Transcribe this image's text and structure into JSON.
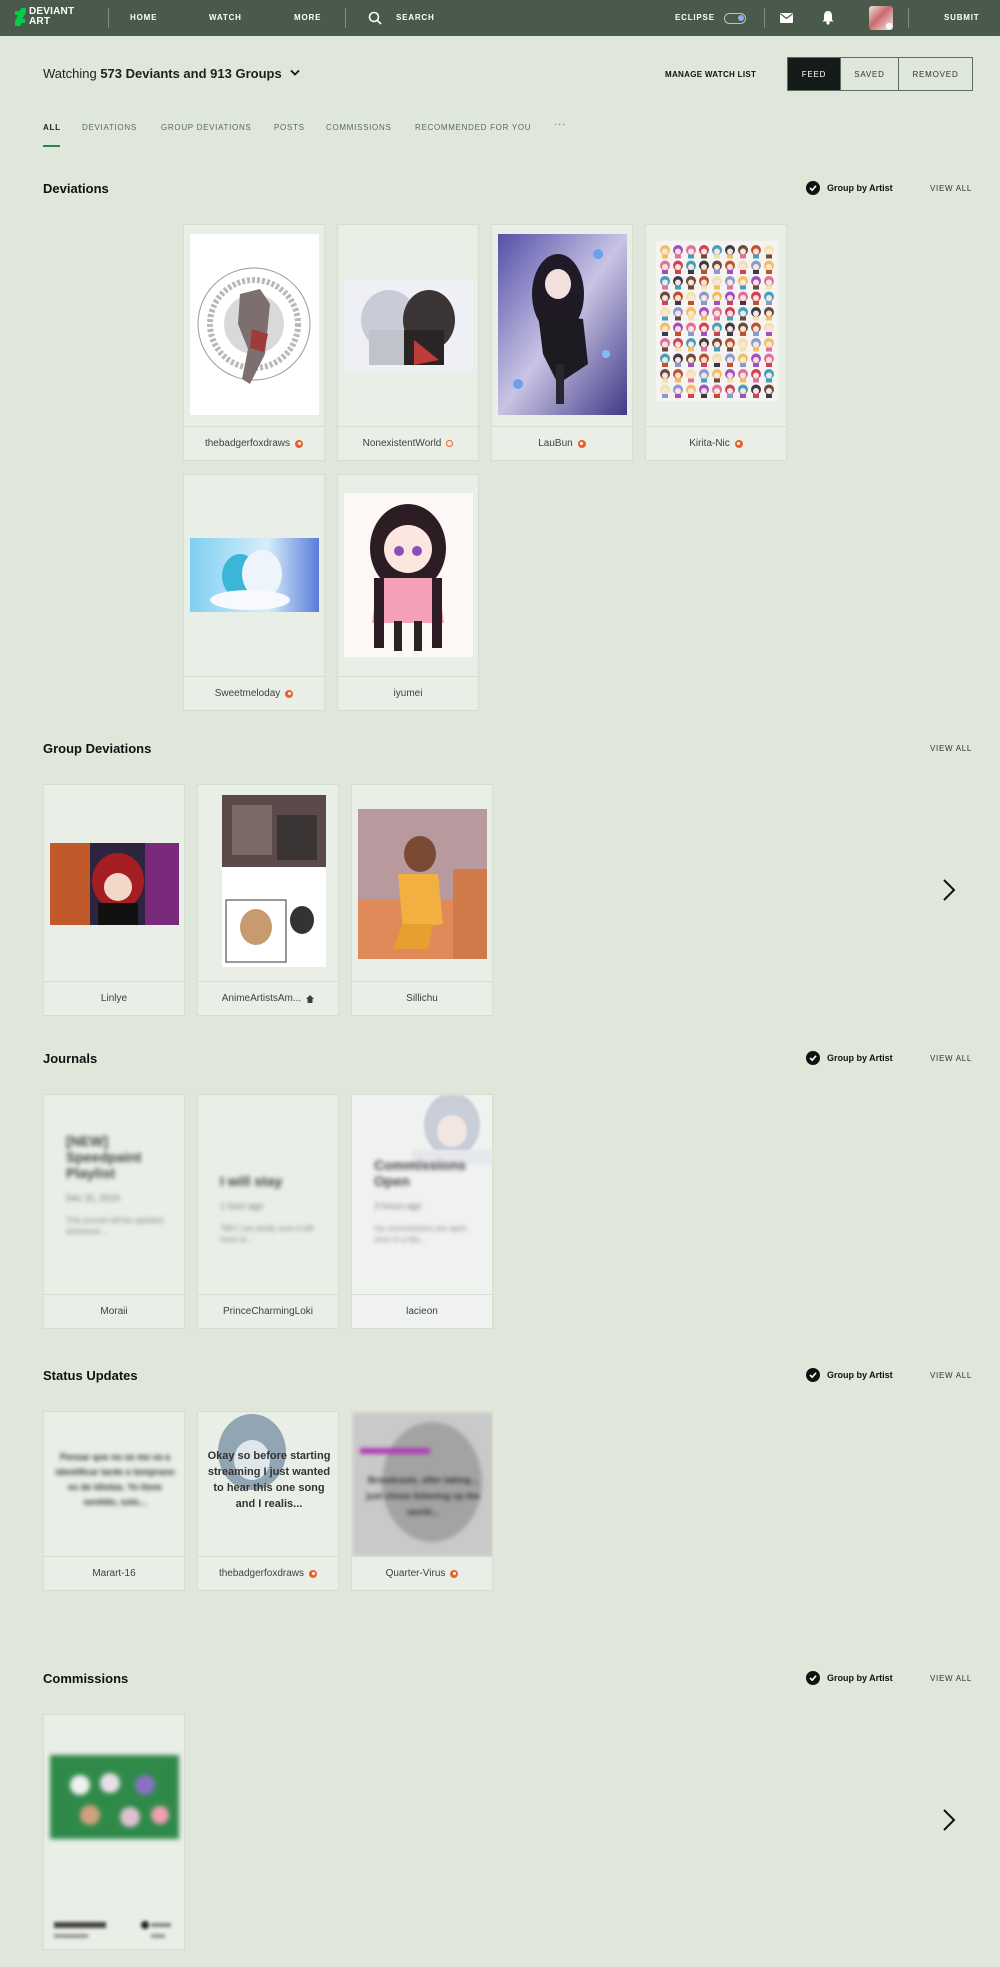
{
  "nav": {
    "logo_text_1": "DEVIANT",
    "logo_text_2": "ART",
    "home": "HOME",
    "watch": "WATCH",
    "more": "MORE",
    "search": "SEARCH",
    "eclipse": "ECLIPSE",
    "submit": "SUBMIT"
  },
  "header": {
    "watching_prefix": "Watching ",
    "watching_bold": "573 Deviants and 913 Groups",
    "manage_watch_list": "MANAGE WATCH LIST",
    "segments": [
      "FEED",
      "SAVED",
      "REMOVED"
    ]
  },
  "tabs": [
    "ALL",
    "DEVIATIONS",
    "GROUP DEVIATIONS",
    "POSTS",
    "COMMISSIONS",
    "RECOMMENDED FOR YOU",
    "···"
  ],
  "common": {
    "group_by_artist": "Group by Artist",
    "view_all": "VIEW ALL"
  },
  "deviations": {
    "title": "Deviations",
    "cards": [
      {
        "artist": "thebadgerfoxdraws",
        "badge": "solid"
      },
      {
        "artist": "NonexistentWorld",
        "badge": "hollow"
      },
      {
        "artist": "LauBun",
        "badge": "solid"
      },
      {
        "artist": "Kirita-Nic",
        "badge": "solid"
      },
      {
        "artist": "Sweetmeloday",
        "badge": "solid"
      },
      {
        "artist": "iyumei",
        "badge": "none"
      }
    ]
  },
  "group_deviations": {
    "title": "Group Deviations",
    "cards": [
      {
        "artist": "Linlye"
      },
      {
        "artist": "AnimeArtistsAm..."
      },
      {
        "artist": "Sillichu"
      }
    ]
  },
  "journals": {
    "title": "Journals",
    "cards": [
      {
        "artist": "Moraii",
        "heading": "[NEW] Speedpaint Playlist",
        "date": "Dec 31, 2019",
        "snippet": "This journal will be updated whenever..."
      },
      {
        "artist": "PrinceCharmingLoki",
        "heading": "I will stay",
        "date": "1 hour ago",
        "snippet": "TBH I am pretty sure it will have to..."
      },
      {
        "artist": "lacieon",
        "heading": "Commissions Open",
        "date": "3 hours ago",
        "snippet": "my commissions are open once in a blu..."
      }
    ]
  },
  "status_updates": {
    "title": "Status Updates",
    "cards": [
      {
        "artist": "Marart-16",
        "text": "Pensar que no se me va a identificar tarde o temprano es de idiotas. Yo tiene sentido, solo...",
        "badge": "none"
      },
      {
        "artist": "thebadgerfoxdraws",
        "text": "Okay so before starting streaming I just wanted to hear this one song and I realis...",
        "badge": "solid"
      },
      {
        "artist": "Quarter-Virus",
        "text": "Broadcasts, after taking... just chose listening up the world...",
        "badge": "solid"
      }
    ]
  },
  "commissions": {
    "title": "Commissions"
  }
}
